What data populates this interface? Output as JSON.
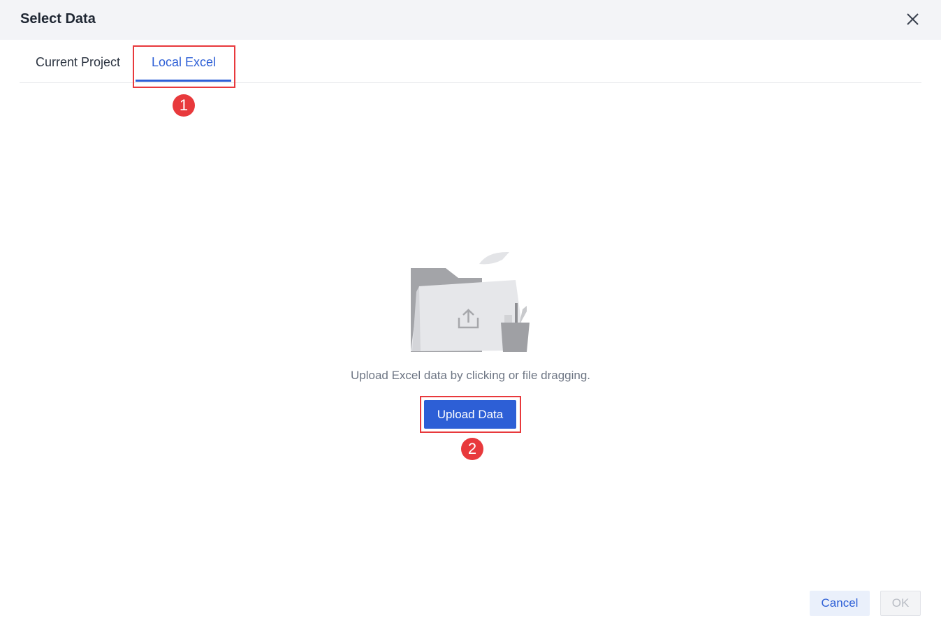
{
  "dialog": {
    "title": "Select Data",
    "close_icon": "close-icon"
  },
  "tabs": [
    {
      "label": "Current Project",
      "active": false
    },
    {
      "label": "Local Excel",
      "active": true
    }
  ],
  "callouts": [
    {
      "number": "1",
      "target": "Local Excel tab"
    },
    {
      "number": "2",
      "target": "Upload Data button"
    }
  ],
  "upload": {
    "illustration_icon": "folder-upload-illustration",
    "hint": "Upload Excel data by clicking or file dragging.",
    "button_label": "Upload Data"
  },
  "footer": {
    "cancel_label": "Cancel",
    "ok_label": "OK",
    "ok_disabled": true
  },
  "colors": {
    "accent": "#2d5fd6",
    "callout": "#e8393c",
    "header_bg": "#f3f4f7"
  }
}
